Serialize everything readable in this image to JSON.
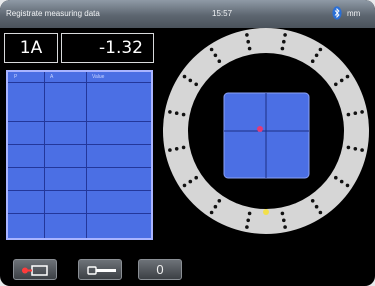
{
  "titlebar": {
    "title": "Registrate measuring data",
    "time": "15:57",
    "unit": "mm"
  },
  "readout": {
    "position_id": "1A",
    "value": "-1.32"
  },
  "table": {
    "header": [
      "P",
      "A",
      "Value"
    ]
  },
  "buttons": {
    "zero_label": "0"
  },
  "colors": {
    "table_blue": "#4b6fe4",
    "target_blue": "#4b6fe4",
    "ring": "#d6d6d6",
    "marker_red": "#e23a78",
    "marker_yellow": "#f2e04a"
  },
  "icons": {
    "bluetooth": "bluetooth-icon",
    "record": "record-icon",
    "tool": "wrench-icon"
  }
}
